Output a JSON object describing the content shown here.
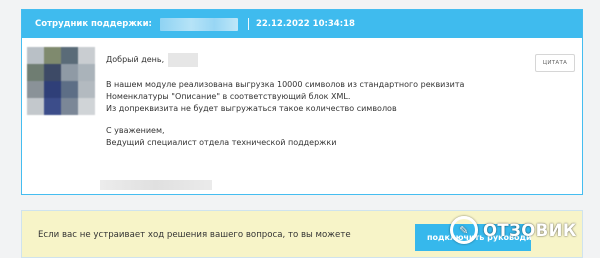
{
  "ticket_reply": {
    "header_label": "Сотрудник поддержки:",
    "date": "22.12.2022 10:34:18",
    "quote_button": "ЦИТАТА",
    "greeting": "Добрый день,",
    "body_lines": [
      "В нашем модуле реализована выгрузка 10000 символов из стандартного реквизита",
      "Номенклатуры \"Описание\" в соответствующий блок XML.",
      "Из допреквизита не будет выгружаться такое количество символов"
    ],
    "closing": "С уважением,",
    "signature_title": "Ведущий специалист отдела технической  поддержки"
  },
  "notice": {
    "text": "Если вас не устраивает ход решения вашего вопроса, то вы можете",
    "button_label": "подключить руководителя"
  },
  "watermark": {
    "text": "ОТЗОВИК",
    "logo_icon": "otzovik-logo-icon"
  },
  "colors": {
    "header_blue": "#3fbbee",
    "notice_bg": "#f7f4c8",
    "button_blue": "#36b8ec"
  }
}
